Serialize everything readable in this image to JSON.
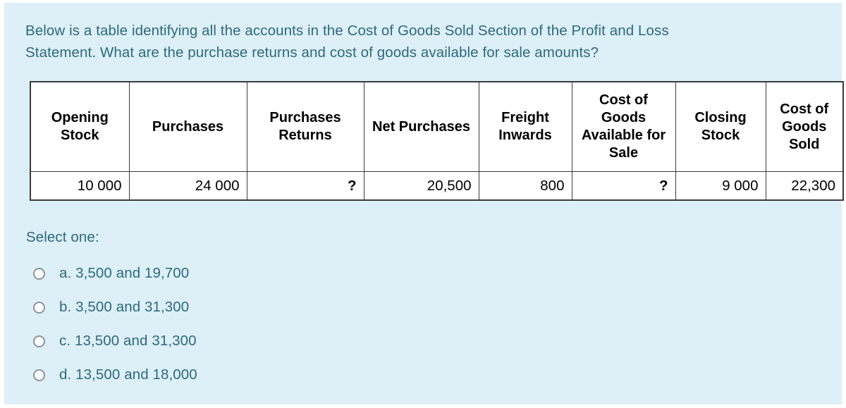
{
  "question": {
    "line1": "Below is a table identifying all the accounts in the Cost of Goods Sold Section of the Profit and Loss",
    "line2": "Statement.  What are the purchase returns and cost of goods available for sale amounts?"
  },
  "table": {
    "headers": [
      "Opening Stock",
      "Purchases",
      "Purchases Returns",
      "Net Purchases",
      "Freight Inwards",
      "Cost of Goods Available for Sale",
      "Closing Stock",
      "Cost of Goods Sold"
    ],
    "row": [
      "10 000",
      "24 000",
      "?",
      "20,500",
      "800",
      "?",
      "9 000",
      "22,300"
    ]
  },
  "answers": {
    "prompt": "Select one:",
    "options": [
      {
        "label": "a. 3,500 and 19,700"
      },
      {
        "label": "b. 3,500 and 31,300"
      },
      {
        "label": "c. 13,500 and 31,300"
      },
      {
        "label": "d. 13,500 and 18,000"
      }
    ]
  },
  "colors": {
    "panel_background": "#ddeff7",
    "text": "#2c6a7c",
    "table_border": "#3b3b3b",
    "table_background": "#ffffff"
  }
}
